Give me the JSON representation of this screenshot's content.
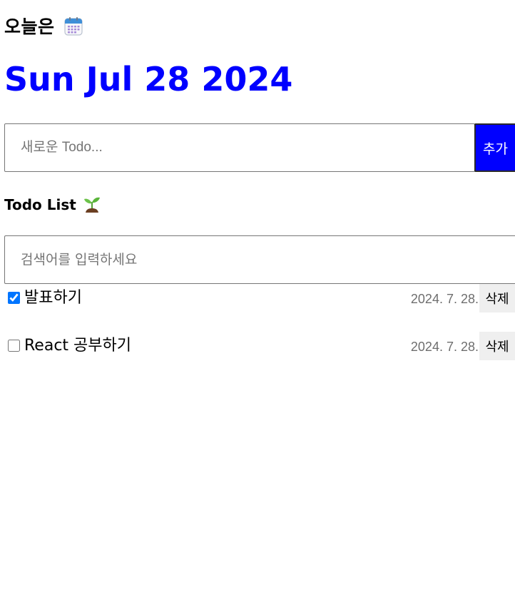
{
  "header": {
    "today_label": "오늘은",
    "calendar_icon": "calendar-icon",
    "date": "Sun Jul 28 2024",
    "date_color": "#0000ff"
  },
  "editor": {
    "placeholder": "새로운 Todo...",
    "value": "",
    "add_label": "추가",
    "add_color": "#0000ff"
  },
  "list": {
    "title": "Todo List",
    "title_icon": "sprout-icon",
    "search_placeholder": "검색어를 입력하세요",
    "search_value": "",
    "items": [
      {
        "content": "발표하기",
        "done": true,
        "date": "2024. 7. 28.",
        "delete_label": "삭제"
      },
      {
        "content": "React 공부하기",
        "done": false,
        "date": "2024. 7. 28.",
        "delete_label": "삭제"
      }
    ]
  }
}
